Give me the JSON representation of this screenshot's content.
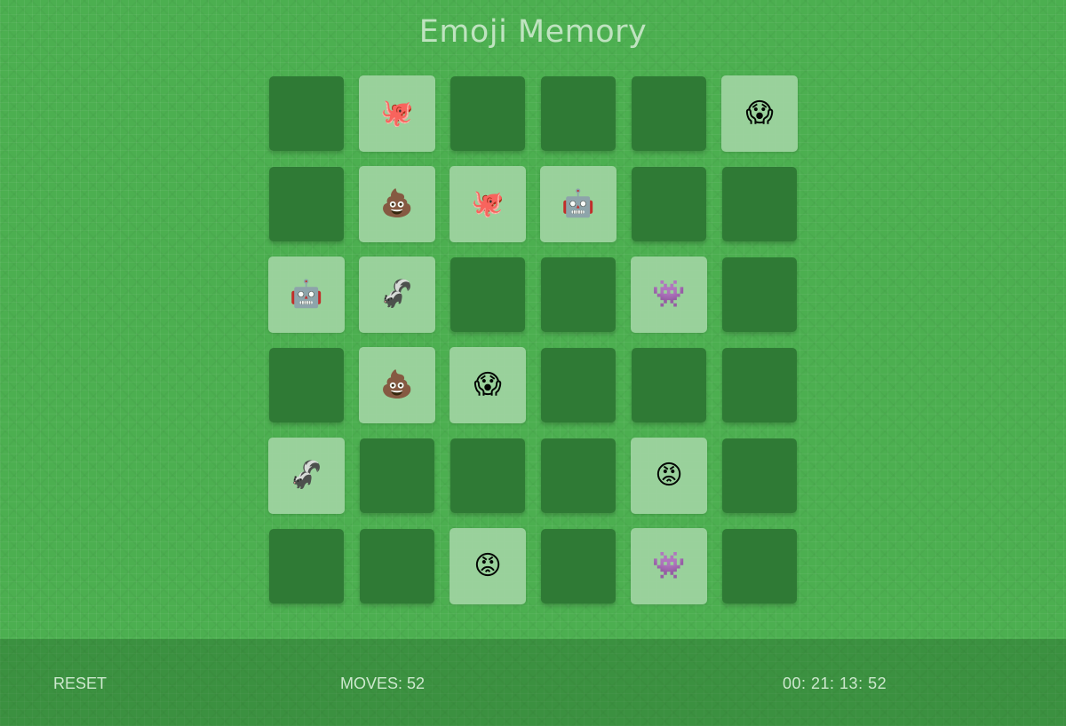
{
  "title": "Emoji Memory",
  "footer": {
    "reset_label": "RESET",
    "moves_label": "MOVES: 52",
    "timer": "00: 21: 13: 52"
  },
  "colors": {
    "background": "#4caf50",
    "card_face_down": "#2f7a35",
    "card_face_up": "#9dd39f",
    "title": "#bfe3c0"
  },
  "board": {
    "rows": 6,
    "cols": 6,
    "cards": [
      {
        "state": "down",
        "emoji": "",
        "name": ""
      },
      {
        "state": "up",
        "emoji": "🐙",
        "name": "octopus"
      },
      {
        "state": "down",
        "emoji": "",
        "name": ""
      },
      {
        "state": "down",
        "emoji": "",
        "name": ""
      },
      {
        "state": "down",
        "emoji": "",
        "name": ""
      },
      {
        "state": "up",
        "emoji": "😱",
        "name": "screaming-face"
      },
      {
        "state": "down",
        "emoji": "",
        "name": ""
      },
      {
        "state": "up",
        "emoji": "💩",
        "name": "pile-of-poo"
      },
      {
        "state": "up",
        "emoji": "🐙",
        "name": "octopus"
      },
      {
        "state": "up",
        "emoji": "🤖",
        "name": "robot"
      },
      {
        "state": "down",
        "emoji": "",
        "name": ""
      },
      {
        "state": "down",
        "emoji": "",
        "name": ""
      },
      {
        "state": "up",
        "emoji": "🤖",
        "name": "robot"
      },
      {
        "state": "up",
        "emoji": "🦨",
        "name": "skunk"
      },
      {
        "state": "down",
        "emoji": "",
        "name": ""
      },
      {
        "state": "down",
        "emoji": "",
        "name": ""
      },
      {
        "state": "up",
        "emoji": "👾",
        "name": "alien-monster"
      },
      {
        "state": "down",
        "emoji": "",
        "name": ""
      },
      {
        "state": "down",
        "emoji": "",
        "name": ""
      },
      {
        "state": "up",
        "emoji": "💩",
        "name": "pile-of-poo"
      },
      {
        "state": "up",
        "emoji": "😱",
        "name": "screaming-face"
      },
      {
        "state": "down",
        "emoji": "",
        "name": ""
      },
      {
        "state": "down",
        "emoji": "",
        "name": ""
      },
      {
        "state": "down",
        "emoji": "",
        "name": ""
      },
      {
        "state": "up",
        "emoji": "🦨",
        "name": "skunk"
      },
      {
        "state": "down",
        "emoji": "",
        "name": ""
      },
      {
        "state": "down",
        "emoji": "",
        "name": ""
      },
      {
        "state": "down",
        "emoji": "",
        "name": ""
      },
      {
        "state": "up",
        "emoji": "😡",
        "name": "angry-face"
      },
      {
        "state": "down",
        "emoji": "",
        "name": ""
      },
      {
        "state": "down",
        "emoji": "",
        "name": ""
      },
      {
        "state": "down",
        "emoji": "",
        "name": ""
      },
      {
        "state": "up",
        "emoji": "😡",
        "name": "angry-face"
      },
      {
        "state": "down",
        "emoji": "",
        "name": ""
      },
      {
        "state": "up",
        "emoji": "👾",
        "name": "alien-monster"
      },
      {
        "state": "down",
        "emoji": "",
        "name": ""
      }
    ]
  }
}
